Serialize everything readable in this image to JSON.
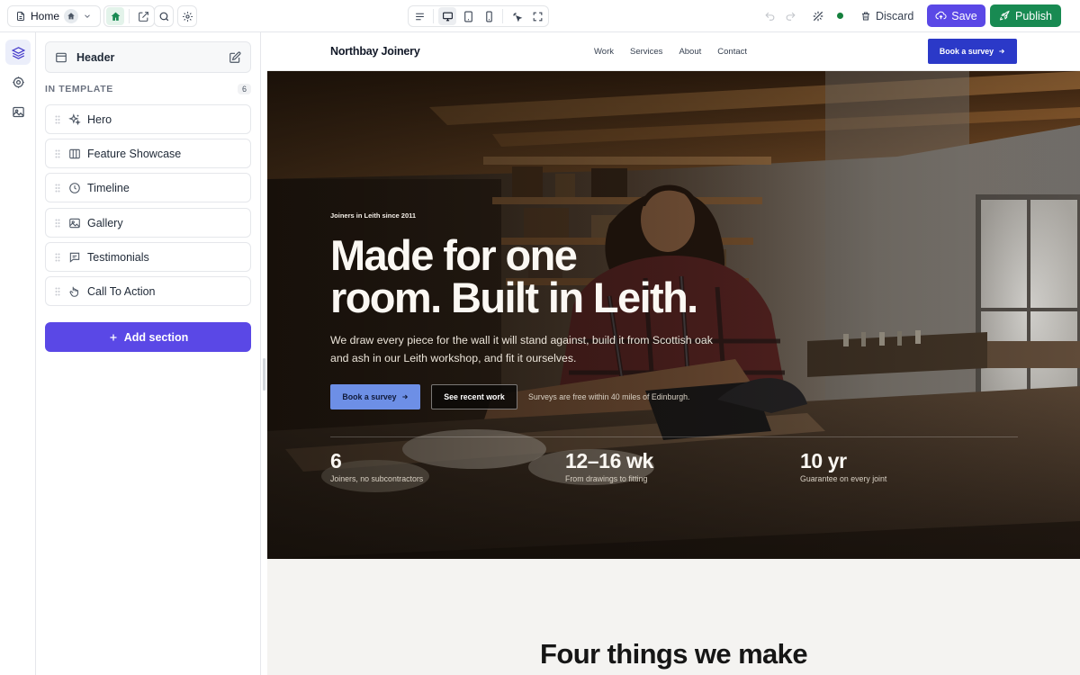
{
  "toolbar": {
    "page_name": "Home",
    "discard_label": "Discard",
    "save_label": "Save",
    "publish_label": "Publish",
    "icons": [
      "file-icon",
      "home-icon",
      "chevron-down-icon",
      "home-icon",
      "external-edit-icon",
      "search-icon",
      "settings-icon",
      "align-left-icon",
      "desktop-icon",
      "tablet-icon",
      "mobile-icon",
      "pointer-icon",
      "fullscreen-icon",
      "undo-icon",
      "redo-icon",
      "ai-disabled-icon",
      "trash-icon",
      "cloud-upload-icon",
      "rocket-icon"
    ],
    "colors": {
      "save": "#5a48e6",
      "publish": "#188a52",
      "status": "#15803d"
    }
  },
  "rail": {
    "icons": [
      "layers-icon",
      "settings-icon",
      "image-icon"
    ]
  },
  "panel": {
    "header_label": "Header",
    "in_template_label": "IN TEMPLATE",
    "in_template_count": "6",
    "sections": [
      {
        "label": "Hero",
        "icon": "sparkles-icon"
      },
      {
        "label": "Feature Showcase",
        "icon": "columns-icon"
      },
      {
        "label": "Timeline",
        "icon": "clock-icon"
      },
      {
        "label": "Gallery",
        "icon": "image-icon"
      },
      {
        "label": "Testimonials",
        "icon": "message-icon"
      },
      {
        "label": "Call To Action",
        "icon": "pointer-icon"
      }
    ],
    "add_section_label": "Add section"
  },
  "site": {
    "brand": "Northbay Joinery",
    "nav": [
      "Work",
      "Services",
      "About",
      "Contact"
    ],
    "nav_cta": "Book a survey",
    "hero": {
      "eyebrow": "Joiners in Leith since 2011",
      "headline_line1": "Made for one",
      "headline_line2": "room. Built in Leith.",
      "subtext": "We draw every piece for the wall it will stand against, build it from Scottish oak and ash in our Leith workshop, and fit it ourselves.",
      "primary_cta": "Book a survey",
      "secondary_cta": "See recent work",
      "note": "Surveys are free within 40 miles of Edinburgh.",
      "stats": [
        {
          "value": "6",
          "caption": "Joiners, no subcontractors"
        },
        {
          "value": "12–16 wk",
          "caption": "From drawings to fitting"
        },
        {
          "value": "10 yr",
          "caption": "Guarantee on every joint"
        }
      ]
    },
    "next_section_heading": "Four things we make"
  }
}
